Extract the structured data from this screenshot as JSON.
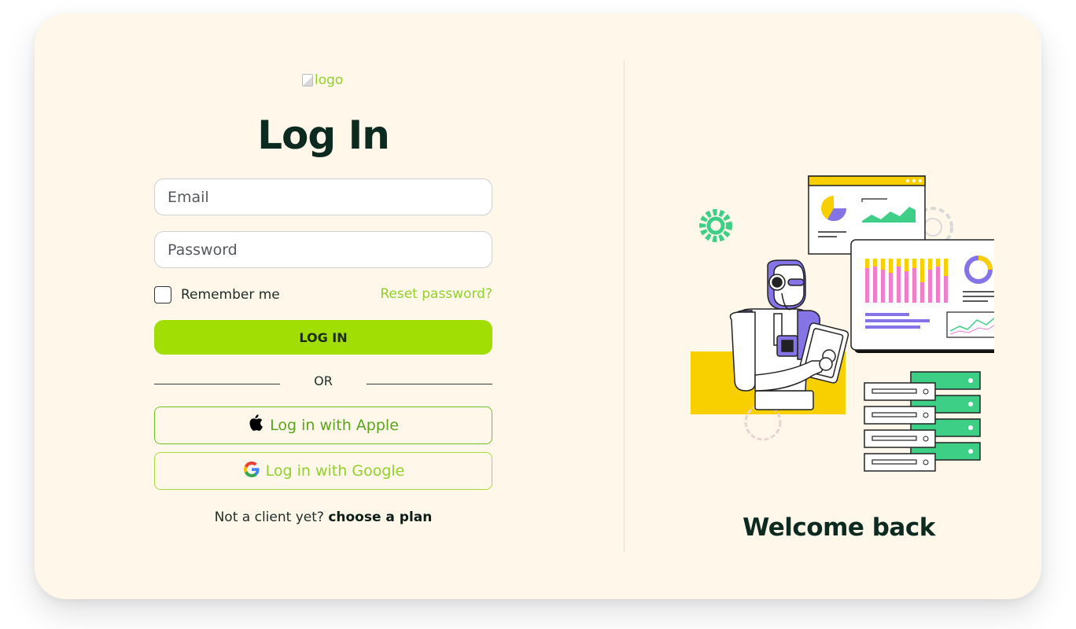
{
  "logo": {
    "alt": "logo"
  },
  "login": {
    "title": "Log In",
    "email_placeholder": "Email",
    "password_placeholder": "Password",
    "remember_label": "Remember me",
    "reset_link": "Reset password?",
    "login_button": "LOG IN",
    "or_text": "OR",
    "apple_button": "Log in with Apple",
    "google_button": "Log in with Google",
    "signup_prompt": "Not a client yet?",
    "signup_link": "choose a plan"
  },
  "welcome": {
    "text": "Welcome back"
  },
  "colors": {
    "accent": "#a1de04",
    "link": "#8fd12a",
    "heading": "#0c2a20",
    "card_bg": "#fff8ea"
  }
}
